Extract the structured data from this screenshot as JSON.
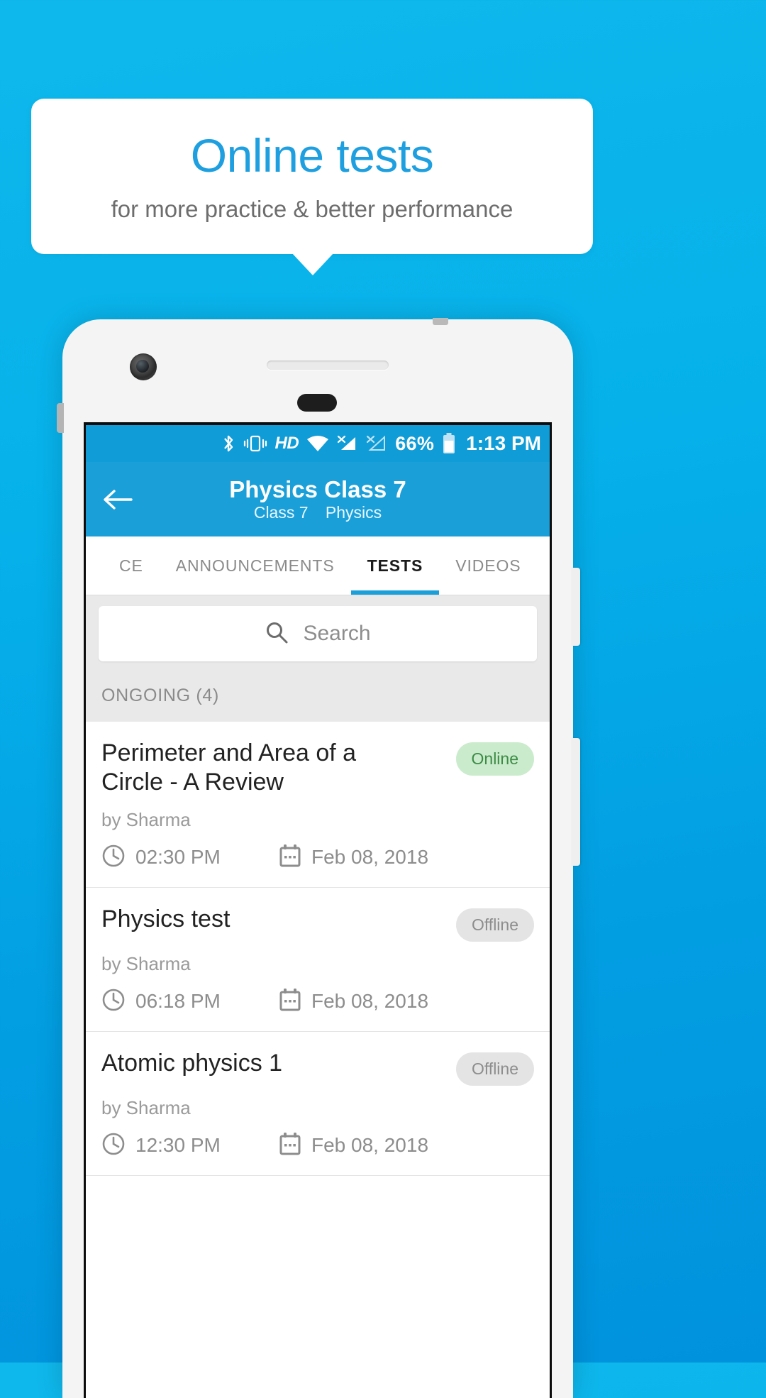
{
  "promo": {
    "title": "Online tests",
    "subtitle": "for more practice & better performance",
    "title_color": "#1e9fe0",
    "subtitle_color": "#6d6d6d",
    "background_color": "#06b1ea"
  },
  "statusbar": {
    "bluetooth_icon": "bluetooth-icon",
    "vibrate_icon": "vibrate-icon",
    "hd_label": "HD",
    "wifi_icon": "wifi-icon",
    "signal1_icon": "signal-no-service-icon",
    "signal2_icon": "signal-no-sim-icon",
    "battery_percent": "66%",
    "battery_icon": "battery-icon",
    "time": "1:13 PM"
  },
  "appbar": {
    "back_icon": "back-arrow-icon",
    "title": "Physics Class 7",
    "subtitle_class": "Class 7",
    "subtitle_subject": "Physics",
    "background_color": "#1a9fd9"
  },
  "tabs": {
    "items": [
      {
        "label": "CE",
        "active": false
      },
      {
        "label": "ANNOUNCEMENTS",
        "active": false
      },
      {
        "label": "TESTS",
        "active": true
      },
      {
        "label": "VIDEOS",
        "active": false
      }
    ],
    "indicator_color": "#1a9fd9"
  },
  "search": {
    "icon": "search-icon",
    "placeholder": "Search",
    "value": ""
  },
  "section": {
    "label": "ONGOING (4)"
  },
  "tests": [
    {
      "title": "Perimeter and Area of a Circle - A Review",
      "author": "by Sharma",
      "status": "Online",
      "status_type": "online",
      "time": "02:30 PM",
      "date": "Feb 08, 2018",
      "clock_icon": "clock-icon",
      "calendar_icon": "calendar-icon"
    },
    {
      "title": "Physics test",
      "author": "by Sharma",
      "status": "Offline",
      "status_type": "offline",
      "time": "06:18 PM",
      "date": "Feb 08, 2018",
      "clock_icon": "clock-icon",
      "calendar_icon": "calendar-icon"
    },
    {
      "title": "Atomic physics 1",
      "author": "by Sharma",
      "status": "Offline",
      "status_type": "offline",
      "time": "12:30 PM",
      "date": "Feb 08, 2018",
      "clock_icon": "clock-icon",
      "calendar_icon": "calendar-icon"
    }
  ],
  "colors": {
    "accent": "#1a9fd9",
    "badge_online_bg": "#cbebcd",
    "badge_online_text": "#3c8c45",
    "badge_offline_bg": "#e4e4e4",
    "badge_offline_text": "#8d8d8d"
  }
}
